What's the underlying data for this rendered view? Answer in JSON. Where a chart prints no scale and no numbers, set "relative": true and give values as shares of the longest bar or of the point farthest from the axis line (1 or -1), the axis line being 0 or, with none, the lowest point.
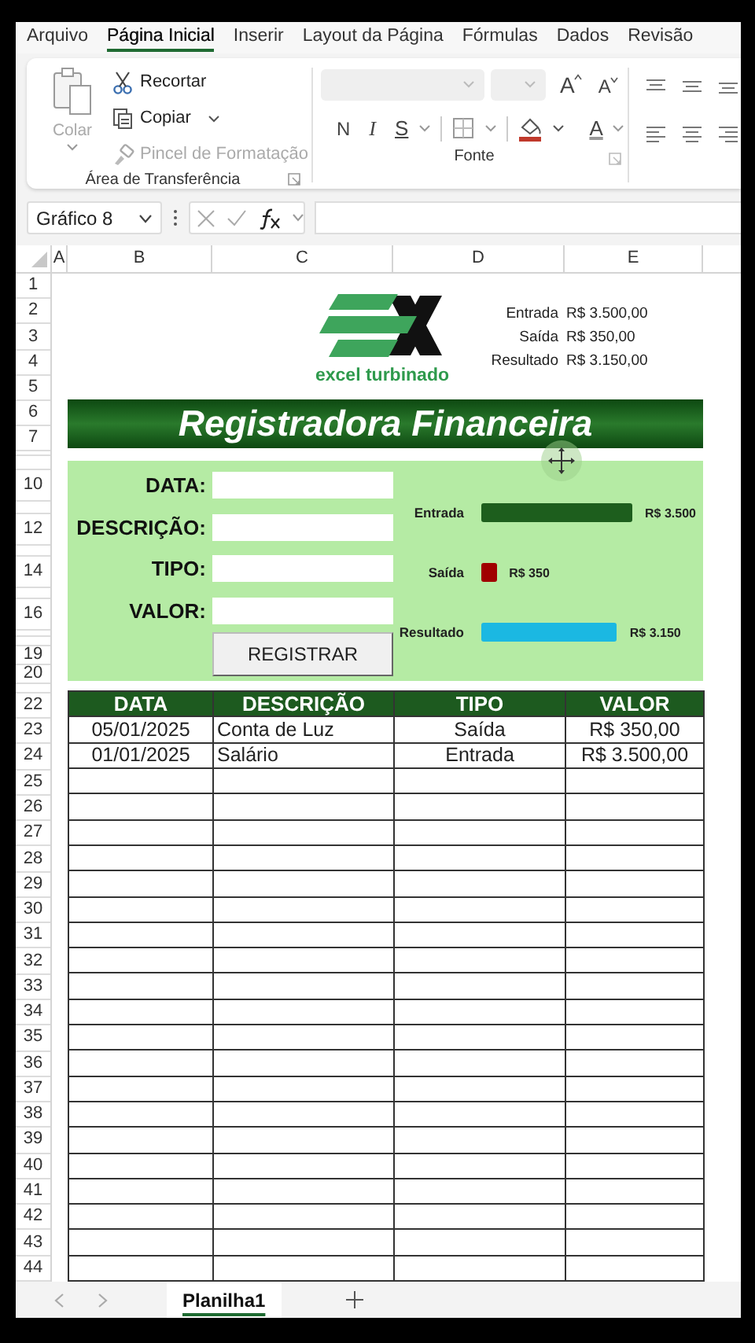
{
  "ribbon": {
    "tabs": [
      {
        "label": "Arquivo",
        "selected": false
      },
      {
        "label": "Página Inicial",
        "selected": true
      },
      {
        "label": "Inserir",
        "selected": false
      },
      {
        "label": "Layout da Página",
        "selected": false
      },
      {
        "label": "Fórmulas",
        "selected": false
      },
      {
        "label": "Dados",
        "selected": false
      },
      {
        "label": "Revisão",
        "selected": false
      }
    ],
    "clipboard": {
      "group_label": "Área de Transferência",
      "paste": {
        "label": "Colar",
        "disabled": true
      },
      "items": [
        {
          "kind": "cut",
          "label": "Recortar",
          "disabled": false,
          "dropdown": false
        },
        {
          "kind": "copy",
          "label": "Copiar",
          "disabled": false,
          "dropdown": true
        },
        {
          "kind": "brush",
          "label": "Pincel de Formatação",
          "disabled": true,
          "dropdown": false
        }
      ]
    },
    "font": {
      "group_label": "Fonte",
      "grow_button": "A",
      "shrink_button": "A",
      "bold_button": "N",
      "italic_button": "I",
      "underline_button": "S",
      "font_color_button": "A"
    }
  },
  "formula_bar": {
    "name_box": "Gráfico 8"
  },
  "sheet": {
    "columns": [
      "A",
      "B",
      "C",
      "D",
      "E"
    ],
    "row_numbers": [
      "1",
      "2",
      "3",
      "4",
      "5",
      "6",
      "7",
      "10",
      "12",
      "14",
      "16",
      "19",
      "20",
      "22",
      "23",
      "24",
      "25",
      "26",
      "27",
      "28",
      "29",
      "30",
      "31",
      "32",
      "33",
      "34",
      "35",
      "36",
      "37",
      "38",
      "39",
      "40",
      "41",
      "42",
      "43",
      "44"
    ]
  },
  "logo_text": "excel turbinado",
  "summary": [
    {
      "label": "Entrada",
      "value": "R$ 3.500,00"
    },
    {
      "label": "Saída",
      "value": "R$ 350,00"
    },
    {
      "label": "Resultado",
      "value": "R$ 3.150,00"
    }
  ],
  "title": "Registradora Financeira",
  "form": {
    "fields": [
      {
        "label": "DATA:"
      },
      {
        "label": "DESCRIÇÃO:"
      },
      {
        "label": "TIPO:"
      },
      {
        "label": "VALOR:"
      }
    ],
    "button": "REGISTRAR",
    "chart_data": {
      "type": "bar",
      "orientation": "horizontal",
      "relative": true,
      "categories": [
        "Entrada",
        "Saída",
        "Resultado"
      ],
      "series": [
        {
          "values": [
            1,
            0.1,
            0.9
          ]
        }
      ],
      "colors": [
        "#1d5e1d",
        "#a00000",
        "#1bb8e2"
      ],
      "value_labels": [
        "R$ 3.500",
        "R$ 350",
        "R$ 3.150"
      ]
    }
  },
  "table": {
    "columns": [
      "DATA",
      "DESCRIÇÃO",
      "TIPO",
      "VALOR"
    ],
    "rows": [
      [
        "05/01/2025",
        "Conta de Luz",
        "Saída",
        "R$ 350,00"
      ],
      [
        "01/01/2025",
        "Salário",
        "Entrada",
        "R$ 3.500,00"
      ]
    ]
  },
  "sheet_tabs": [
    {
      "label": "Planilha1",
      "selected": true
    }
  ]
}
